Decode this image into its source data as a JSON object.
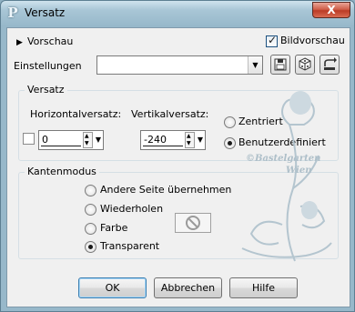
{
  "window": {
    "title": "Versatz",
    "close_glyph": "X"
  },
  "preview": {
    "toggle_label": "Vorschau",
    "checkbox_label": "Bildvorschau",
    "checked": true
  },
  "settings": {
    "label": "Einstellungen",
    "value": ""
  },
  "offset_group": {
    "title": "Versatz",
    "horizontal_label": "Horizontalversatz:",
    "horizontal_value": "0",
    "vertical_label": "Vertikalversatz:",
    "vertical_value": "-240",
    "link_checked": false,
    "options": [
      {
        "label": "Zentriert",
        "selected": false
      },
      {
        "label": "Benutzerdefiniert",
        "selected": true
      }
    ]
  },
  "edge_group": {
    "title": "Kantenmodus",
    "options": [
      {
        "label": "Andere Seite übernehmen",
        "selected": false
      },
      {
        "label": "Wiederholen",
        "selected": false
      },
      {
        "label": "Farbe",
        "selected": false
      },
      {
        "label": "Transparent",
        "selected": true
      }
    ]
  },
  "watermark": {
    "line1": "©Bastelgarten",
    "line2": "Wien"
  },
  "buttons": {
    "ok": "OK",
    "cancel": "Abbrechen",
    "help": "Hilfe"
  },
  "colors": {
    "window_frame": "#97b8ca",
    "client_bg": "#f0f0f0",
    "close_red": "#c84a33",
    "watermark": "#b4c5cf"
  }
}
